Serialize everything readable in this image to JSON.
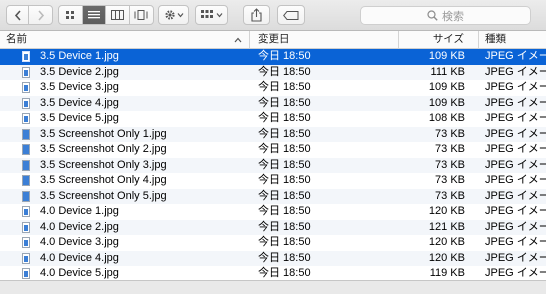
{
  "toolbar": {
    "back_icon": "chevron-left-icon",
    "forward_icon": "chevron-right-icon",
    "view_modes": [
      {
        "name": "icon-view",
        "icon": "grid-icon"
      },
      {
        "name": "list-view",
        "icon": "list-icon",
        "active": true
      },
      {
        "name": "column-view",
        "icon": "columns-icon"
      },
      {
        "name": "coverflow-view",
        "icon": "coverflow-icon"
      }
    ],
    "action_icon": "gear-icon",
    "arrange_icon": "arrange-grid-icon",
    "share_icon": "share-icon",
    "tags_icon": "tag-icon",
    "search_placeholder": "検索"
  },
  "columns": {
    "name": "名前",
    "date": "変更日",
    "size": "サイズ",
    "kind": "種類"
  },
  "files": [
    {
      "name": "3.5 Device 1.jpg",
      "date": "今日 18:50",
      "size": "109 KB",
      "kind": "JPEG イメージ",
      "selected": true
    },
    {
      "name": "3.5 Device 2.jpg",
      "date": "今日 18:50",
      "size": "111 KB",
      "kind": "JPEG イメージ"
    },
    {
      "name": "3.5 Device 3.jpg",
      "date": "今日 18:50",
      "size": "109 KB",
      "kind": "JPEG イメージ"
    },
    {
      "name": "3.5 Device 4.jpg",
      "date": "今日 18:50",
      "size": "109 KB",
      "kind": "JPEG イメージ"
    },
    {
      "name": "3.5 Device 5.jpg",
      "date": "今日 18:50",
      "size": "108 KB",
      "kind": "JPEG イメージ"
    },
    {
      "name": "3.5 Screenshot Only 1.jpg",
      "date": "今日 18:50",
      "size": "73 KB",
      "kind": "JPEG イメージ"
    },
    {
      "name": "3.5 Screenshot Only 2.jpg",
      "date": "今日 18:50",
      "size": "73 KB",
      "kind": "JPEG イメージ"
    },
    {
      "name": "3.5 Screenshot Only 3.jpg",
      "date": "今日 18:50",
      "size": "73 KB",
      "kind": "JPEG イメージ"
    },
    {
      "name": "3.5 Screenshot Only 4.jpg",
      "date": "今日 18:50",
      "size": "73 KB",
      "kind": "JPEG イメージ"
    },
    {
      "name": "3.5 Screenshot Only 5.jpg",
      "date": "今日 18:50",
      "size": "73 KB",
      "kind": "JPEG イメージ"
    },
    {
      "name": "4.0 Device 1.jpg",
      "date": "今日 18:50",
      "size": "120 KB",
      "kind": "JPEG イメージ"
    },
    {
      "name": "4.0 Device 2.jpg",
      "date": "今日 18:50",
      "size": "121 KB",
      "kind": "JPEG イメージ"
    },
    {
      "name": "4.0 Device 3.jpg",
      "date": "今日 18:50",
      "size": "120 KB",
      "kind": "JPEG イメージ"
    },
    {
      "name": "4.0 Device 4.jpg",
      "date": "今日 18:50",
      "size": "120 KB",
      "kind": "JPEG イメージ"
    },
    {
      "name": "4.0 Device 5.jpg",
      "date": "今日 18:50",
      "size": "119 KB",
      "kind": "JPEG イメージ"
    }
  ],
  "colors": {
    "selection": "#0a63d6",
    "alt_row": "#f3f6fa"
  }
}
